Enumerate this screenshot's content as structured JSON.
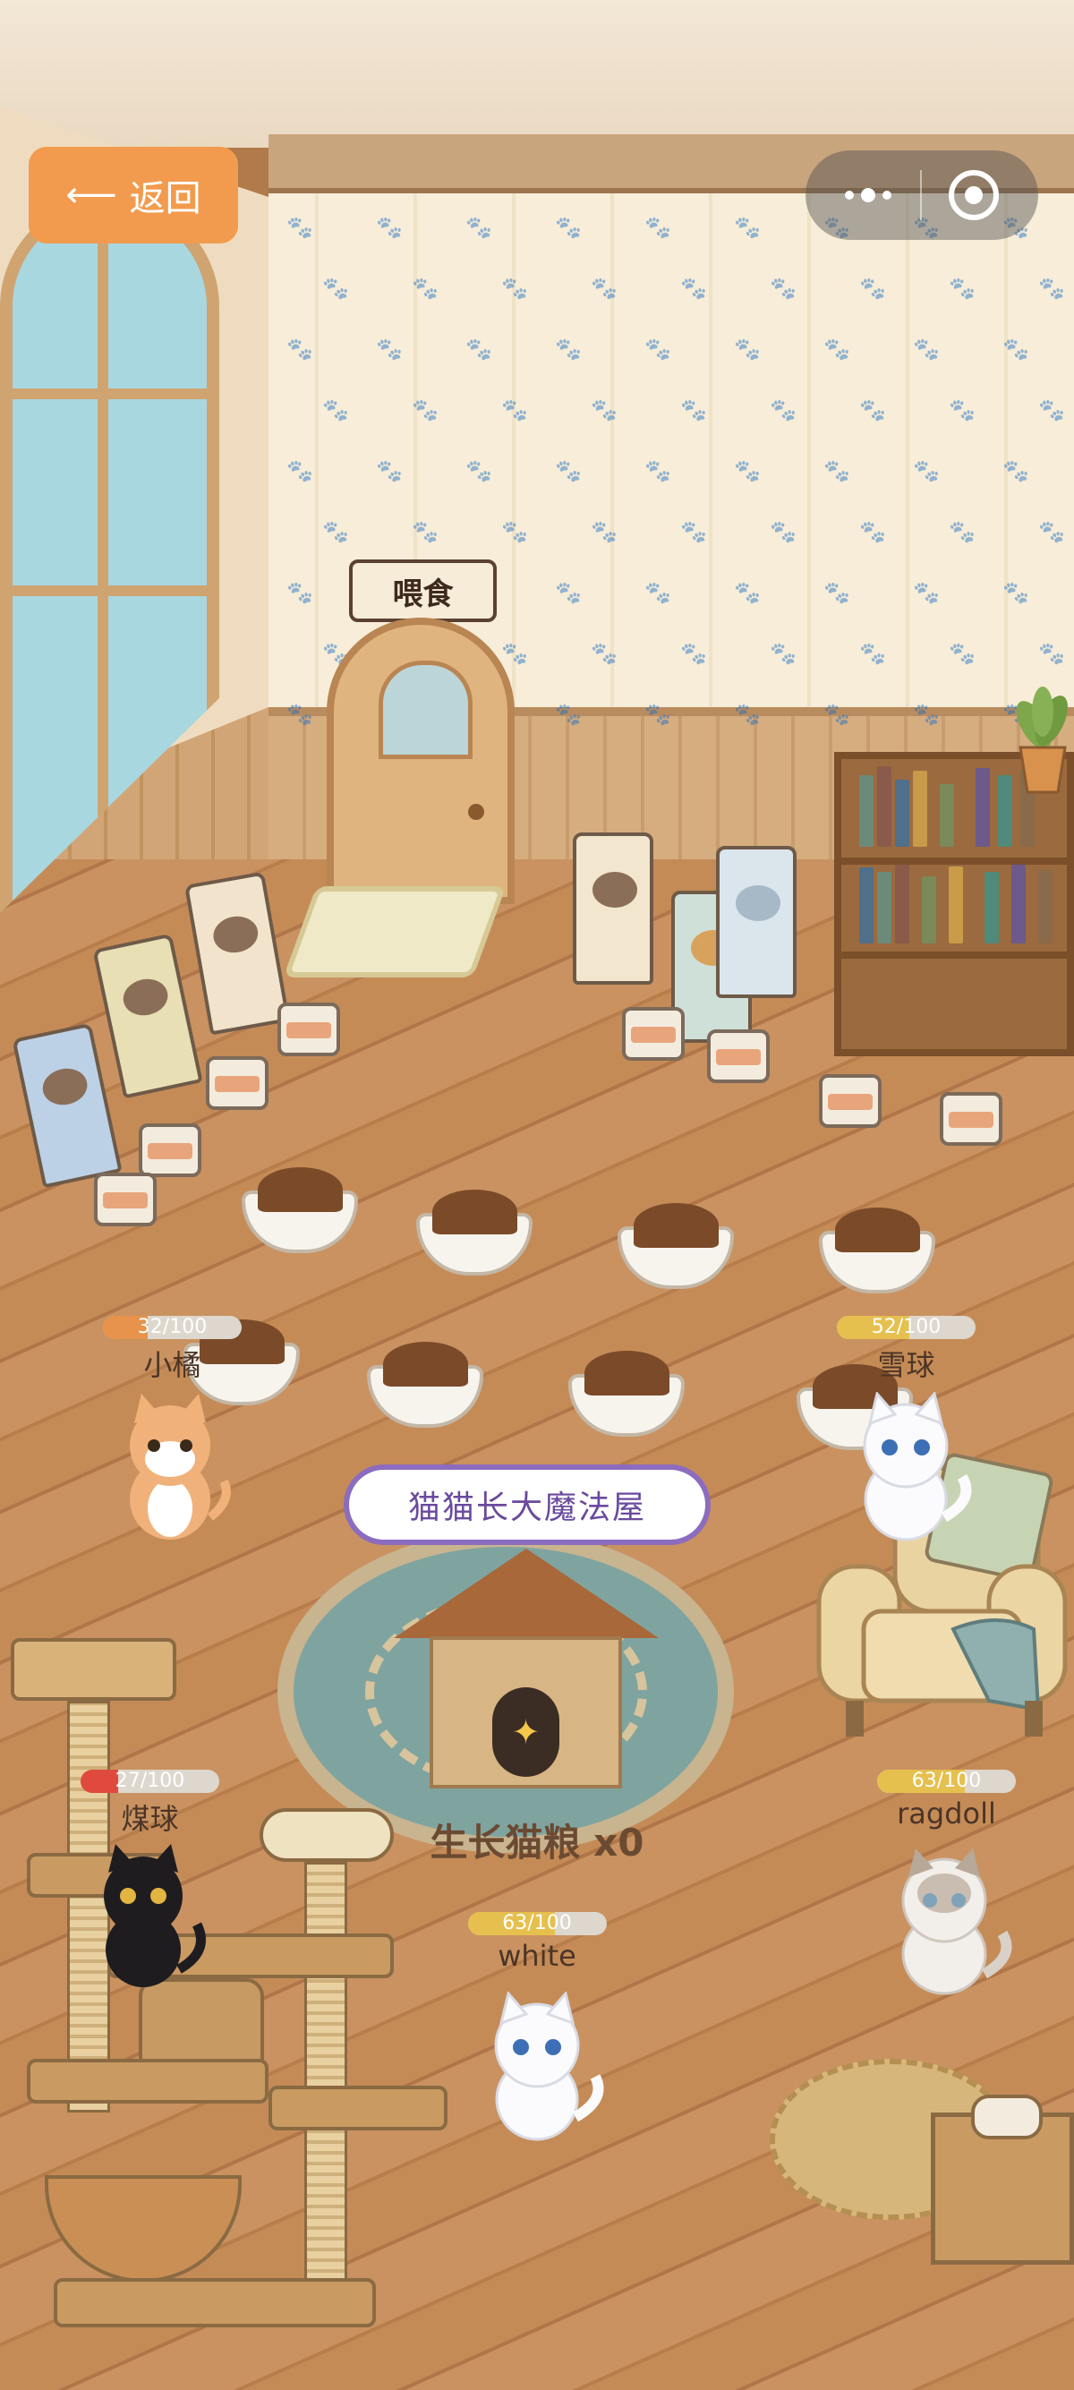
{
  "nav": {
    "back_label": "返回",
    "back_icon": "arrow-left-icon",
    "capsule_icons": [
      "more-dots-icon",
      "close-target-icon"
    ]
  },
  "room": {
    "door_sign": "喂食"
  },
  "magic_house": {
    "title": "猫猫长大魔法屋",
    "food_label": "生长猫粮 x0",
    "sparkle_icon": "sparkle-icon"
  },
  "cats": [
    {
      "name": "小橘",
      "hunger": "32/100",
      "hunger_value": 32,
      "bar_color": "#e7934b",
      "coat": "orange-tabby"
    },
    {
      "name": "雪球",
      "hunger": "52/100",
      "hunger_value": 52,
      "bar_color": "#e6c04f",
      "coat": "white"
    },
    {
      "name": "煤球",
      "hunger": "27/100",
      "hunger_value": 27,
      "bar_color": "#e04a3c",
      "coat": "black"
    },
    {
      "name": "ragdoll",
      "hunger": "63/100",
      "hunger_value": 63,
      "bar_color": "#e6c04f",
      "coat": "ragdoll"
    },
    {
      "name": "white",
      "hunger": "63/100",
      "hunger_value": 63,
      "bar_color": "#e6c04f",
      "coat": "white"
    }
  ],
  "colors": {
    "accent": "#f29b4e",
    "magic_border": "#8c6cbe",
    "magic_text": "#6a4a9e"
  }
}
